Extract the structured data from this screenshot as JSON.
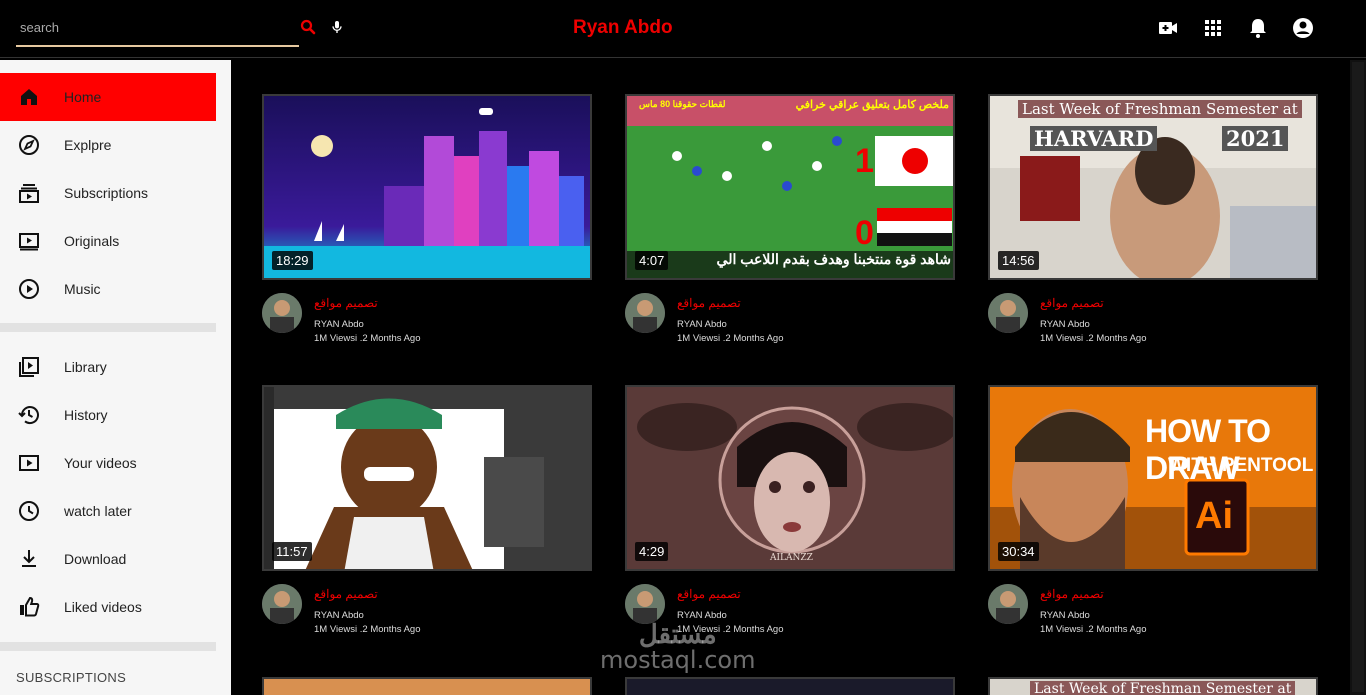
{
  "header": {
    "search_placeholder": "search",
    "brand": "Ryan Abdo",
    "icons": [
      "search-icon",
      "mic-icon",
      "video-camera-icon",
      "apps-grid-icon",
      "bell-icon",
      "account-icon"
    ]
  },
  "sidebar": {
    "items": [
      {
        "label": "Home",
        "icon": "home-icon"
      },
      {
        "label": "Explpre",
        "icon": "compass-icon"
      },
      {
        "label": "Subscriptions",
        "icon": "subscriptions-icon"
      },
      {
        "label": "Originals",
        "icon": "originals-icon"
      },
      {
        "label": "Music",
        "icon": "music-icon"
      },
      {
        "label": "Library",
        "icon": "library-icon"
      },
      {
        "label": "History",
        "icon": "history-icon"
      },
      {
        "label": "Your videos",
        "icon": "your-videos-icon"
      },
      {
        "label": "watch later",
        "icon": "clock-icon"
      },
      {
        "label": "Download",
        "icon": "download-icon"
      },
      {
        "label": "Liked videos",
        "icon": "thumbs-up-icon"
      }
    ],
    "section_header": "SUBSCRIPTIONS"
  },
  "videos": [
    {
      "duration": "18:29",
      "title": "تصميم مواقع",
      "channel": "RYAN Abdo",
      "stats": "1M Viewsi .2 Months Ago"
    },
    {
      "duration": "4:07",
      "title": "تصميم مواقع",
      "channel": "RYAN Abdo",
      "stats": "1M Viewsi .2 Months Ago",
      "thumb_text": {
        "top": "ملخص كامل بتعليق عراقي خرافي",
        "top2": "لقطات حقوقنا 80 ماس",
        "bottom": "شاهد قوة منتخبنا وهدف بقدم اللاعب الي",
        "score1": "1",
        "score2": "0"
      }
    },
    {
      "duration": "14:56",
      "title": "تصميم مواقع",
      "channel": "RYAN Abdo",
      "stats": "1M Viewsi .2 Months Ago",
      "thumb_text": {
        "line1": "Last Week of Freshman Semester at",
        "line2": "HARVARD",
        "line3": "2021"
      }
    },
    {
      "duration": "11:57",
      "title": "تصميم مواقع",
      "channel": "RYAN Abdo",
      "stats": "1M Viewsi .2 Months Ago"
    },
    {
      "duration": "4:29",
      "title": "تصميم مواقع",
      "channel": "RYAN Abdo",
      "stats": "1M Viewsi .2 Months Ago",
      "thumb_text": {
        "sig": "AILANZZ"
      }
    },
    {
      "duration": "30:34",
      "title": "تصميم مواقع",
      "channel": "RYAN Abdo",
      "stats": "1M Viewsi .2 Months Ago",
      "thumb_text": {
        "line1": "HOW TO DRAW",
        "line2": "WITH PENTOOL",
        "badge": "Ai"
      }
    }
  ],
  "partial_thumb_text": "Last Week of Freshman Semester at",
  "watermark": {
    "ar": "مستقل",
    "en": "mostaql.com"
  },
  "colors": {
    "accent": "#ff0000",
    "brand": "#ee0000",
    "background": "#000000",
    "sidebar": "#f6f6f6"
  }
}
